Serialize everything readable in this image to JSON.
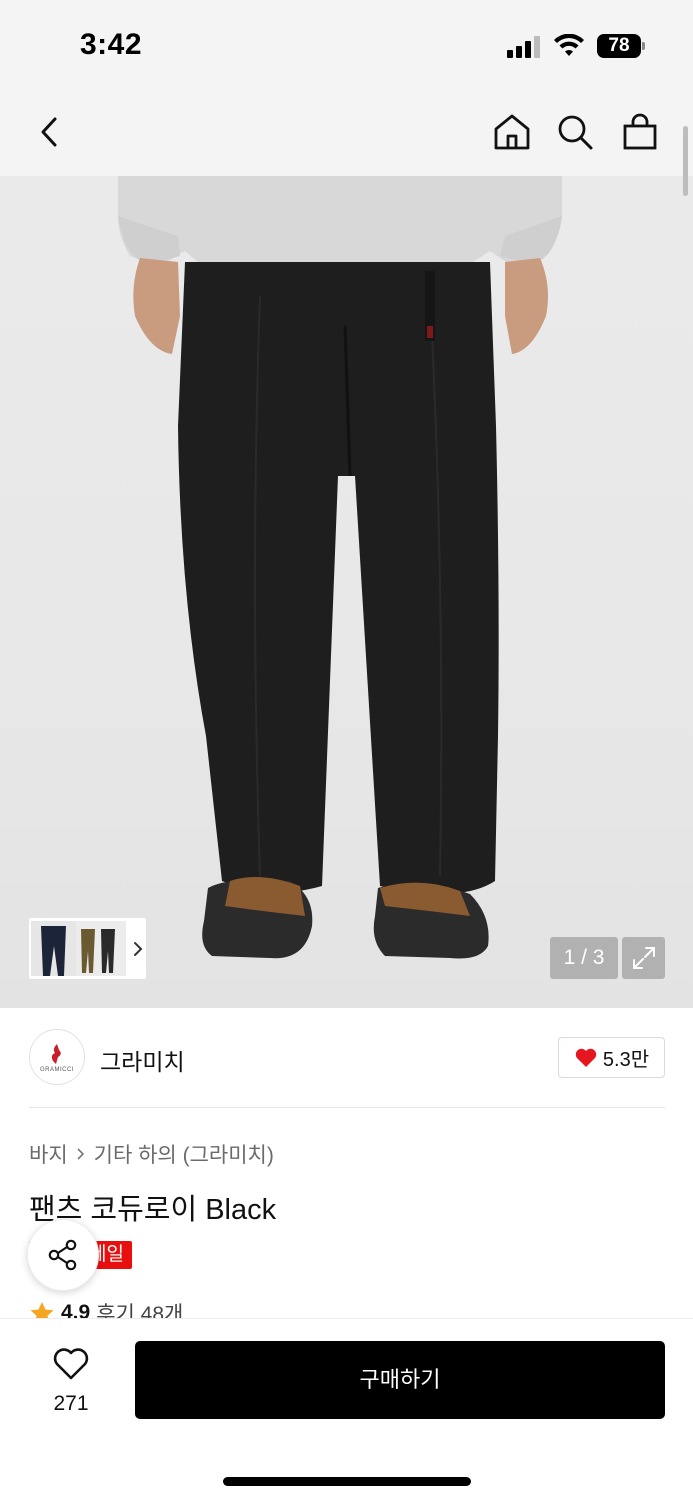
{
  "status_bar": {
    "time": "3:42",
    "battery": "78"
  },
  "nav": {
    "icons": [
      "back-icon",
      "home-icon",
      "search-icon",
      "shopping-bag-icon"
    ]
  },
  "gallery": {
    "page_indicator": "1 / 3",
    "icons": [
      "chevron-right-icon",
      "expand-icon"
    ]
  },
  "brand": {
    "name": "그라미치",
    "likes": "5.3만"
  },
  "product": {
    "breadcrumb": [
      "바지",
      "기타 하의 (그라미치)"
    ],
    "title": "팬츠 코듀로이 Black",
    "badge": "세일",
    "rating": "4.9",
    "reviews": "후기 48개"
  },
  "bottom_bar": {
    "wish_count": "271",
    "buy_label": "구매하기"
  },
  "colors": {
    "sale_red": "#e8100f",
    "heart_red": "#e5161f",
    "star": "#f5a623",
    "buy_button": "#000000"
  }
}
